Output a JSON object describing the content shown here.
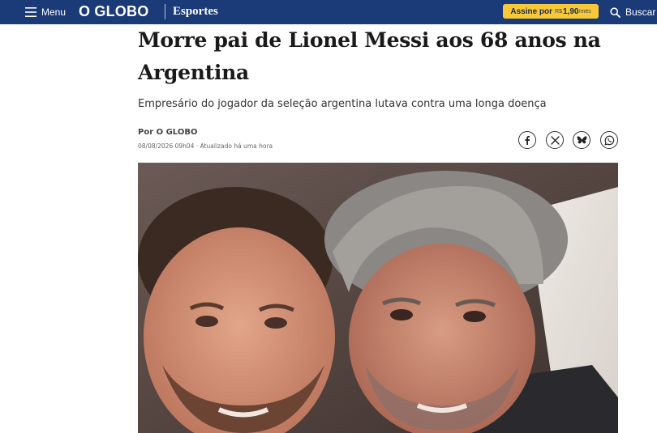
{
  "header": {
    "menu_label": "Menu",
    "logo_text": "O GLOBO",
    "section_label": "Esportes",
    "subscribe": {
      "prefix": "Assine por",
      "currency": "R$",
      "price": "1,90",
      "period": "/mês"
    },
    "search_label": "Buscar",
    "colors": {
      "bar": "#1a3a78",
      "subscribe_button": "#f7c938"
    }
  },
  "article": {
    "headline": "Morre pai de Lionel Messi aos 68 anos na Argentina",
    "subheadline": "Empresário do jogador da seleção argentina lutava contra uma longa doença",
    "byline": "Por O GLOBO",
    "dateline": "08/08/2026 09h04 · Atualizado há uma hora"
  },
  "share_buttons": [
    {
      "network": "facebook",
      "icon": "facebook-icon"
    },
    {
      "network": "x",
      "icon": "x-icon"
    },
    {
      "network": "bluesky",
      "icon": "bluesky-icon"
    },
    {
      "network": "whatsapp",
      "icon": "whatsapp-icon"
    }
  ]
}
